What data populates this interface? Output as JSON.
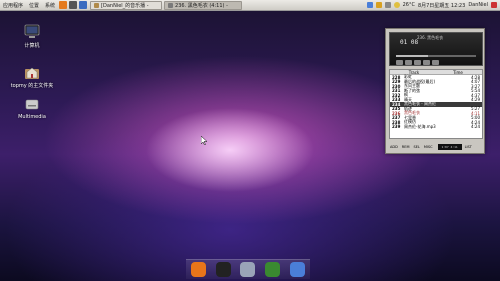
{
  "panel": {
    "menus": [
      "应用程序",
      "位置",
      "系统"
    ],
    "tasks": [
      {
        "label": "[DanNiel_的音乐播 -",
        "active": false
      },
      {
        "label": "236. 黑色毛衣 (4:11) -",
        "active": true
      }
    ],
    "tray": {
      "temperature": "26°C",
      "datetime": "8月7日星期五 12:23",
      "user": "DanNiel"
    }
  },
  "desktop_icons": [
    {
      "label": "计算机",
      "icon": "computer-icon"
    },
    {
      "label": "topmy 的主文件夹",
      "icon": "home-folder-icon"
    },
    {
      "label": "Multimedia",
      "icon": "drive-icon"
    }
  ],
  "player": {
    "time": "01 08",
    "title": "236. 黑色毛衣",
    "columns": [
      "Track",
      "Time"
    ],
    "playlist": [
      {
        "n": "228",
        "title": "彩虹",
        "time": "4:28"
      },
      {
        "n": "229",
        "title": "最后的战役(最后)",
        "time": "4:07"
      },
      {
        "n": "230",
        "title": "东风主题",
        "time": "3:27"
      },
      {
        "n": "231",
        "title": "断了的弦",
        "time": "5:54"
      },
      {
        "n": "232",
        "title": "枫",
        "time": "4:37"
      },
      {
        "n": "233",
        "title": "晴天",
        "time": "4:29"
      },
      {
        "n": "234",
        "title": "黑色毛衣 - 周杰伦",
        "time": "",
        "state": "selected"
      },
      {
        "n": "235",
        "title": "轨迹",
        "time": "5:27"
      },
      {
        "n": "236",
        "title": "黑色毛衣",
        "time": "4:11",
        "state": "playing"
      },
      {
        "n": "237",
        "title": "七里香",
        "time": "5:00"
      },
      {
        "n": "238",
        "title": "红模仿",
        "time": "4:24"
      },
      {
        "n": "239",
        "title": "周杰伦-花海.mp3",
        "time": "4:24"
      }
    ],
    "bottom_buttons": [
      "ADD",
      "REM",
      "SEL",
      "MISC",
      "LIST"
    ],
    "mini_time": "1:07 4:11"
  },
  "dock": [
    {
      "name": "firefox-icon",
      "color": "#e8751a"
    },
    {
      "name": "qq-icon",
      "color": "#222222"
    },
    {
      "name": "audio-player-icon",
      "color": "#9aa4b8"
    },
    {
      "name": "vim-icon",
      "color": "#3a8a30"
    },
    {
      "name": "network-icon",
      "color": "#4a7ed8"
    }
  ]
}
